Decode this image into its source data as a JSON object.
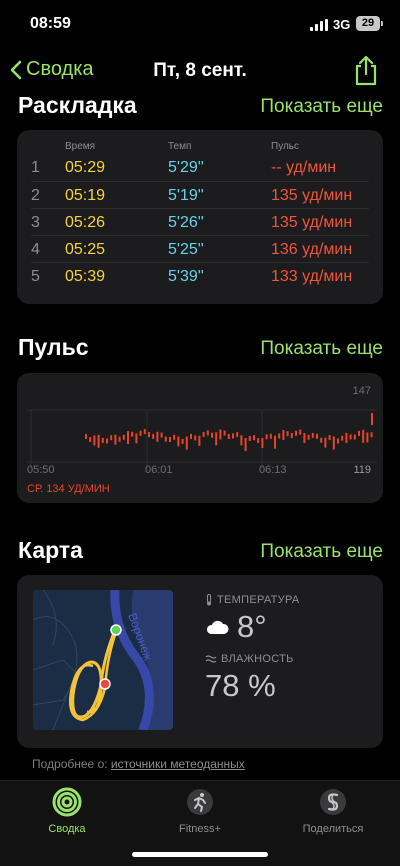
{
  "status": {
    "time": "08:59",
    "network": "3G",
    "battery": "29"
  },
  "nav": {
    "back_label": "Сводка",
    "title": "Пт, 8 сент."
  },
  "splits": {
    "title": "Раскладка",
    "more": "Показать еще",
    "headers": {
      "time": "Время",
      "pace": "Темп",
      "hr": "Пульс"
    },
    "rows": [
      {
        "num": "1",
        "time": "05:29",
        "pace": "5'29''",
        "hr": "-- уд/мин"
      },
      {
        "num": "2",
        "time": "05:19",
        "pace": "5'19''",
        "hr": "135 уд/мин"
      },
      {
        "num": "3",
        "time": "05:26",
        "pace": "5'26''",
        "hr": "135 уд/мин"
      },
      {
        "num": "4",
        "time": "05:25",
        "pace": "5'25''",
        "hr": "136 уд/мин"
      },
      {
        "num": "5",
        "time": "05:39",
        "pace": "5'39''",
        "hr": "133 уд/мин"
      }
    ]
  },
  "heart": {
    "title": "Пульс",
    "more": "Показать еще",
    "max_label": "147",
    "min_label": "119",
    "x_labels": [
      "05:50",
      "06:01",
      "06:13"
    ],
    "avg_label": "СР. 134 УД/МИН",
    "color": "#e8442a"
  },
  "map": {
    "title": "Карта",
    "more": "Показать еще",
    "river_label": "Воронеж",
    "temp_label": "ТЕМПЕРАТУРА",
    "temp_value": "8°",
    "humidity_label": "ВЛАЖНОСТЬ",
    "humidity_value": "78 %"
  },
  "source": {
    "prefix": "Подробнее о: ",
    "link": "источники метеоданных"
  },
  "tabs": [
    {
      "label": "Сводка",
      "icon": "rings-icon"
    },
    {
      "label": "Fitness+",
      "icon": "runner-icon"
    },
    {
      "label": "Поделиться",
      "icon": "sharing-icon"
    }
  ],
  "colors": {
    "accent": "#9ae36a",
    "time": "#f5d33c",
    "pace": "#66d4e8",
    "hr": "#f2553a"
  }
}
